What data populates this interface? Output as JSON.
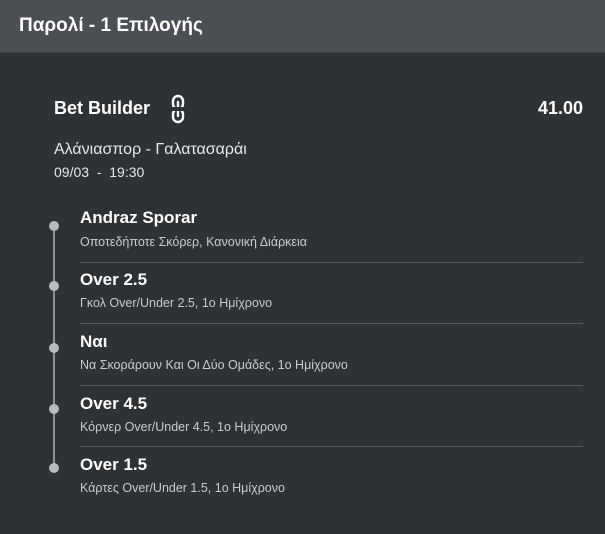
{
  "header": {
    "title": "Παρολί - 1 Επιλογής"
  },
  "bet": {
    "title": "Bet Builder",
    "link_icon": "link-icon",
    "odds": "41.00",
    "match": "Αλάνιασπορ - Γαλατασαράι",
    "datetime": "09/03  -  19:30"
  },
  "selections": [
    {
      "title": "Andraz Sporar",
      "market": "Οποτεδήποτε Σκόρερ, Κανονική Διάρκεια"
    },
    {
      "title": "Over 2.5",
      "market": "Γκολ Over/Under 2.5, 1ο Ημίχρονο"
    },
    {
      "title": "Ναι",
      "market": "Να Σκοράρουν Και Οι Δύο Ομάδες, 1ο Ημίχρονο"
    },
    {
      "title": "Over 4.5",
      "market": "Κόρνερ Over/Under 4.5, 1ο Ημίχρονο"
    },
    {
      "title": "Over 1.5",
      "market": "Κάρτες Over/Under 1.5, 1ο Ημίχρονο"
    }
  ],
  "colors": {
    "background": "#2f3235",
    "header_background": "#4b4e52",
    "timeline": "#8d9094",
    "divider": "#55585c"
  }
}
